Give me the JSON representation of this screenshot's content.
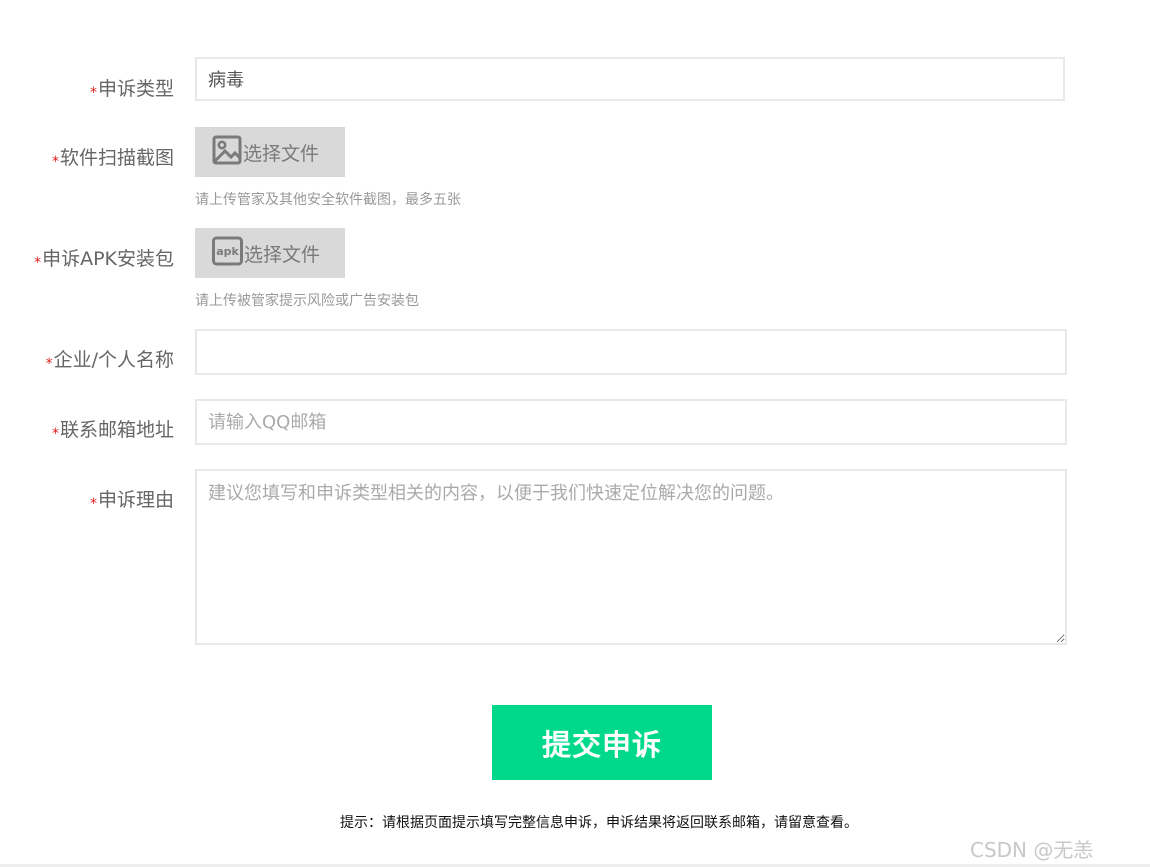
{
  "form": {
    "required_mark": "*",
    "appeal_type": {
      "label": "申诉类型",
      "value": "病毒"
    },
    "screenshot": {
      "label": "软件扫描截图",
      "button_label": "选择文件",
      "icon": "image-icon",
      "hint": "请上传管家及其他安全软件截图，最多五张"
    },
    "apk": {
      "label": "申诉APK安装包",
      "button_label": "选择文件",
      "icon": "apk-icon",
      "icon_text": "apk",
      "hint": "请上传被管家提示风险或广告安装包"
    },
    "name": {
      "label": "企业/个人名称",
      "value": ""
    },
    "email": {
      "label": "联系邮箱地址",
      "placeholder": "请输入QQ邮箱"
    },
    "reason": {
      "label": "申诉理由",
      "placeholder": "建议您填写和申诉类型相关的内容，以便于我们快速定位解决您的问题。"
    },
    "submit_label": "提交申诉",
    "tip": "提示：请根据页面提示填写完整信息申诉，申诉结果将返回联系邮箱，请留意查看。"
  },
  "watermark": "CSDN @无恙",
  "colors": {
    "accent": "#00d98b",
    "required": "#e02020",
    "file_button_bg": "#d9d9d9"
  }
}
